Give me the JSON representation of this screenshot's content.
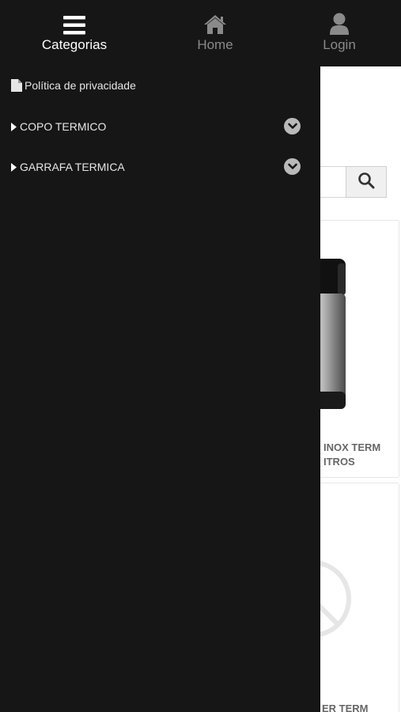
{
  "nav": {
    "categorias_label": "Categorias",
    "home_label": "Home",
    "login_label": "Login",
    "categorias_icon": "hamburger-menu-icon",
    "home_icon": "home-icon",
    "login_icon": "user-icon"
  },
  "drawer": {
    "items": [
      {
        "label": "Política de privacidade",
        "icon": "document-icon"
      },
      {
        "label": "COPO TERMICO",
        "icon": "caret-right-icon",
        "expand_icon": "chevron-down-circle-icon"
      },
      {
        "label": "GARRAFA TERMICA",
        "icon": "caret-right-icon",
        "expand_icon": "chevron-down-circle-icon"
      }
    ]
  },
  "page": {
    "search_icon": "search-icon",
    "products": [
      {
        "name_line1": "INOX TERM",
        "name_line2": "ITROS"
      },
      {
        "name_line1": "ER TERM"
      }
    ]
  },
  "colors": {
    "bar_bg": "#161616",
    "drawer_bg": "#161616",
    "active_label": "#ffffff",
    "inactive_label": "#8a8a8a"
  }
}
